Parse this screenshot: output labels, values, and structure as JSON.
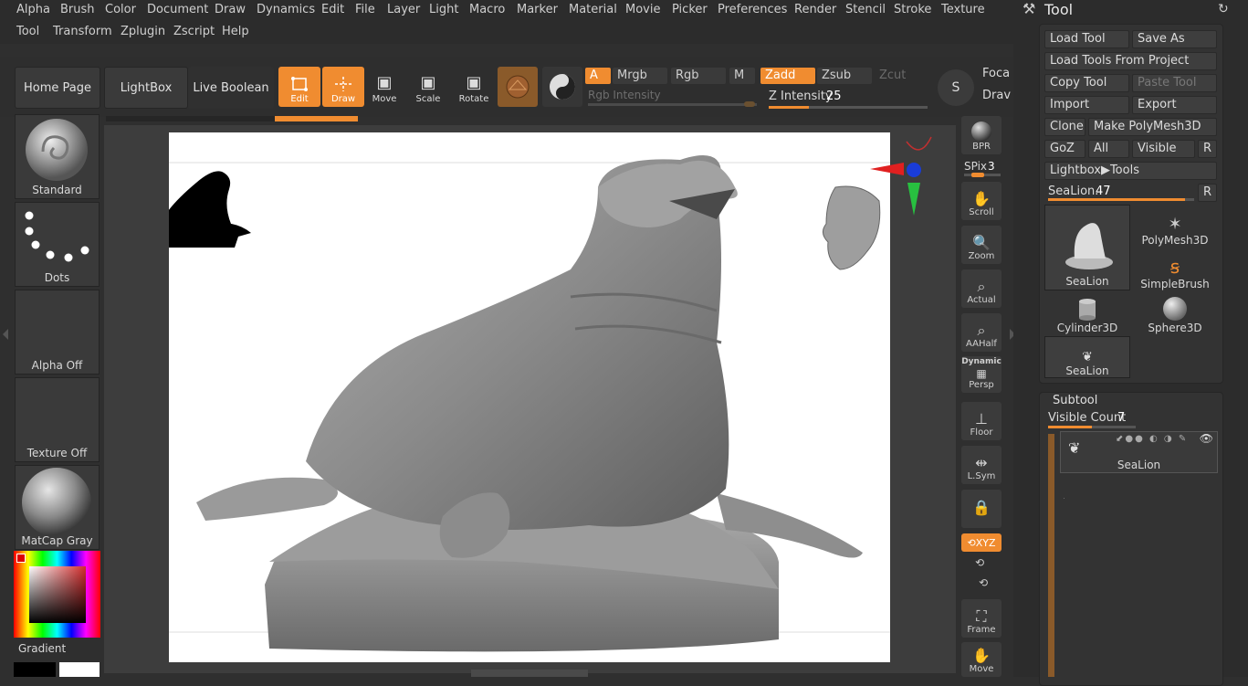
{
  "menu": {
    "row1": [
      "Alpha",
      "Brush",
      "Color",
      "Document",
      "Draw",
      "Dynamics",
      "Edit",
      "File",
      "Layer",
      "Light",
      "Macro",
      "Marker",
      "Material",
      "Movie",
      "Picker",
      "Preferences",
      "Render",
      "Stencil",
      "Stroke",
      "Texture"
    ],
    "row2": [
      "Tool",
      "Transform",
      "Zplugin",
      "Zscript",
      "Help"
    ]
  },
  "shelf": {
    "home_page": "Home Page",
    "lightbox": "LightBox",
    "live_boolean": "Live Boolean",
    "edit": "Edit",
    "draw": "Draw",
    "move": "Move",
    "scale": "Scale",
    "rotate": "Rotate",
    "a": "A",
    "mrgb": "Mrgb",
    "rgb": "Rgb",
    "m": "M",
    "zadd": "Zadd",
    "zsub": "Zsub",
    "zcut": "Zcut",
    "rgb_intensity": "Rgb Intensity",
    "z_intensity_label": "Z Intensity",
    "z_intensity_value": "25",
    "z_intensity_fraction": 0.25,
    "focal": "Foca",
    "draw_size": "Drav",
    "s_label": "S"
  },
  "left_panel": {
    "brush": "Standard",
    "stroke": "Dots",
    "alpha": "Alpha Off",
    "texture": "Texture Off",
    "material": "MatCap Gray",
    "gradient": "Gradient"
  },
  "nav": {
    "bpr": "BPR",
    "spix_label": "SPix",
    "spix_value": "3",
    "scroll": "Scroll",
    "zoom": "Zoom",
    "actual": "Actual",
    "aahalf": "AAHalf",
    "dynamic": "Dynamic",
    "persp": "Persp",
    "floor": "Floor",
    "lsym": "L.Sym",
    "xyz": "XYZ",
    "frame": "Frame",
    "move": "Move"
  },
  "tool_panel": {
    "title": "Tool",
    "load_tool": "Load Tool",
    "save_as": "Save As",
    "load_from_project": "Load Tools From Project",
    "copy_tool": "Copy Tool",
    "paste_tool": "Paste Tool",
    "import": "Import",
    "export": "Export",
    "clone": "Clone",
    "make_polymesh": "Make PolyMesh3D",
    "goz": "GoZ",
    "all": "All",
    "visible": "Visible",
    "r": "R",
    "lightbox_tools": "Lightbox▶Tools",
    "sealion_label": "SeaLion.",
    "sealion_value": "47",
    "sealion_fraction": 0.94,
    "thumbs": [
      "SeaLion",
      "PolyMesh3D",
      "SimpleBrush",
      "Cylinder3D",
      "Sphere3D",
      "SeaLion"
    ]
  },
  "subtool": {
    "title": "Subtool",
    "visible_count_label": "Visible Count",
    "visible_count_value": "7",
    "visible_count_fraction": 0.5,
    "item": "SeaLion"
  },
  "colors": {
    "accent": "#f08c30",
    "panel": "#333333",
    "canvas": "#ffffff"
  }
}
